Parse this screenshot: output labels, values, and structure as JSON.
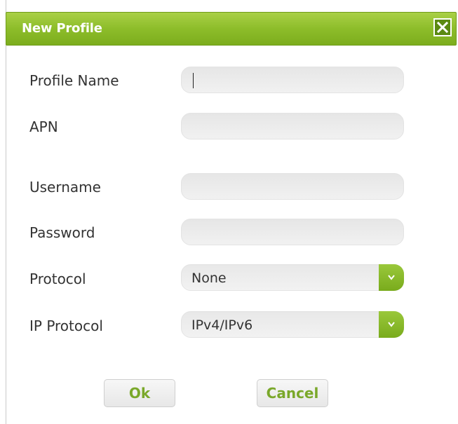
{
  "dialog": {
    "title": "New Profile",
    "close_icon": "close-icon"
  },
  "form": {
    "profile_name": {
      "label": "Profile Name",
      "value": ""
    },
    "apn": {
      "label": "APN",
      "value": ""
    },
    "username": {
      "label": "Username",
      "value": ""
    },
    "password": {
      "label": "Password",
      "value": ""
    },
    "protocol": {
      "label": "Protocol",
      "selected": "None",
      "icon": "chevron-down-icon"
    },
    "ip_protocol": {
      "label": "IP Protocol",
      "selected": "IPv4/IPv6",
      "icon": "chevron-down-icon"
    }
  },
  "buttons": {
    "ok_label": "Ok",
    "cancel_label": "Cancel"
  },
  "colors": {
    "accent": "#8dbd2a",
    "button_text": "#7aa82a"
  }
}
